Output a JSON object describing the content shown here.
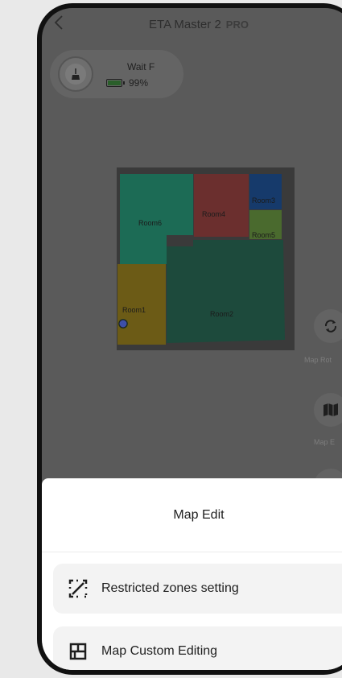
{
  "header": {
    "title": "ETA Master 2",
    "badge": "PRO"
  },
  "status": {
    "state": "Wait F",
    "battery": "99%",
    "battery_level": 0.99
  },
  "map": {
    "rooms": [
      "Room6",
      "Room4",
      "Room3",
      "Room5",
      "Room1",
      "Room2"
    ]
  },
  "side_tools": {
    "rotate_label": "Map Rot",
    "edit_label": "Map E"
  },
  "sheet": {
    "title": "Map Edit",
    "options": [
      {
        "label": "Restricted zones setting",
        "icon": "restricted-zone-icon"
      },
      {
        "label": "Map Custom Editing",
        "icon": "map-custom-edit-icon"
      }
    ]
  },
  "colors": {
    "room6": "#1c6b55",
    "room4": "#6b2f2e",
    "room3": "#163a6b",
    "room5": "#4a6a2e",
    "room1": "#6c5b16",
    "room2": "#1d4a3c",
    "sheet_bg": "#ffffff",
    "option_bg": "#f3f3f3"
  }
}
